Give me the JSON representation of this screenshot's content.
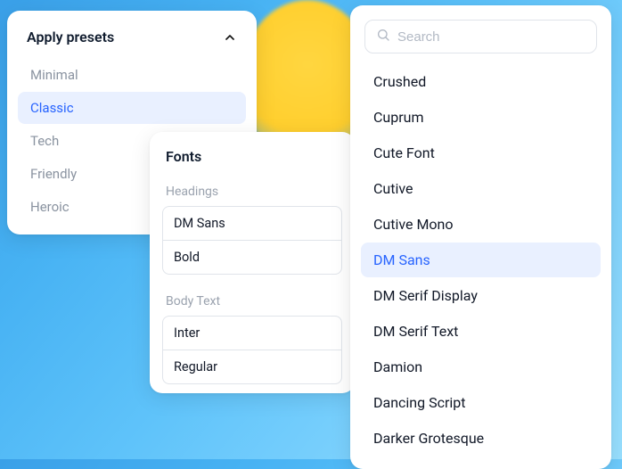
{
  "presets": {
    "title": "Apply presets",
    "items": [
      "Minimal",
      "Classic",
      "Tech",
      "Friendly",
      "Heroic"
    ],
    "selected": "Classic"
  },
  "fonts": {
    "title": "Fonts",
    "headings": {
      "label": "Headings",
      "family": "DM Sans",
      "weight": "Bold"
    },
    "body": {
      "label": "Body Text",
      "family": "Inter",
      "weight": "Regular"
    }
  },
  "fontList": {
    "search": {
      "placeholder": "Search",
      "value": ""
    },
    "items": [
      "Crushed",
      "Cuprum",
      "Cute Font",
      "Cutive",
      "Cutive Mono",
      "DM Sans",
      "DM Serif Display",
      "DM Serif Text",
      "Damion",
      "Dancing Script",
      "Darker Grotesque"
    ],
    "selected": "DM Sans"
  }
}
